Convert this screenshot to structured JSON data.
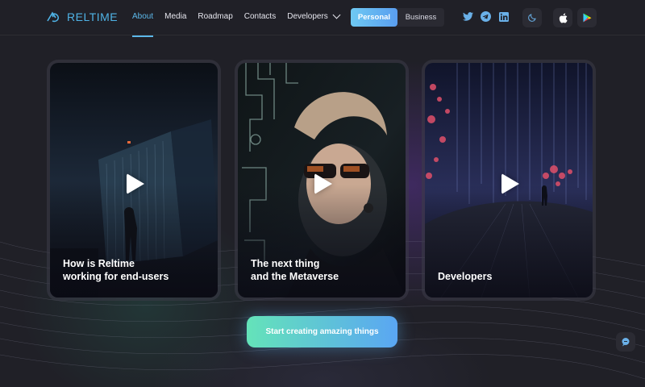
{
  "brand": {
    "name": "RELTIME"
  },
  "nav": {
    "items": [
      {
        "label": "About",
        "active": true
      },
      {
        "label": "Media",
        "active": false
      },
      {
        "label": "Roadmap",
        "active": false
      },
      {
        "label": "Contacts",
        "active": false
      },
      {
        "label": "Developers",
        "active": false,
        "has_dropdown": true
      }
    ]
  },
  "audience_toggle": {
    "options": [
      "Personal",
      "Business"
    ],
    "selected": "Personal"
  },
  "social": [
    "twitter-icon",
    "telegram-icon",
    "linkedin-icon"
  ],
  "actions": [
    "moon-icon",
    "apple-icon",
    "google-play-icon"
  ],
  "cards": [
    {
      "title": "How is Reltime\nworking for end-users",
      "icon": "play-icon"
    },
    {
      "title": "The next thing\nand the Metaverse",
      "icon": "play-icon"
    },
    {
      "title": "Developers",
      "icon": "play-icon"
    }
  ],
  "cta": {
    "label": "Start creating amazing things"
  },
  "colors": {
    "accent": "#5cb8ea",
    "cta_start": "#64e3b9",
    "cta_end": "#5aa6f3",
    "background": "#202027"
  }
}
